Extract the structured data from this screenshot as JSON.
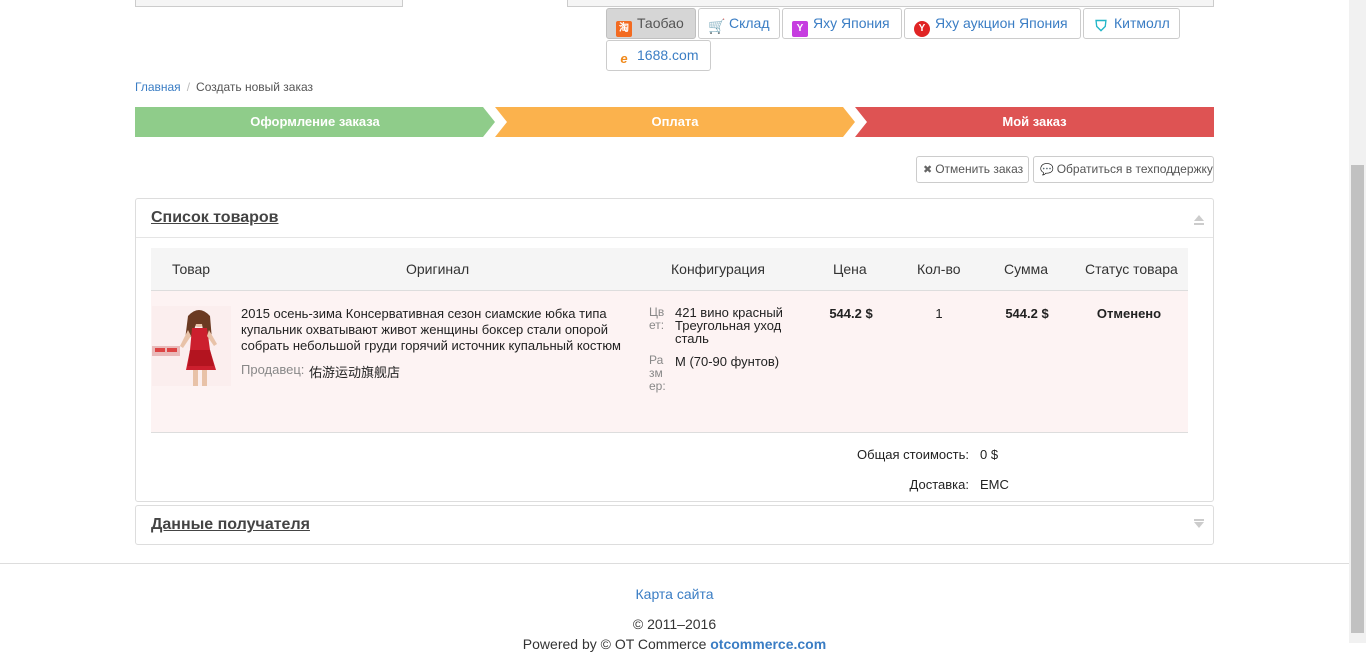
{
  "sources": {
    "tabs": [
      {
        "label": "Таобао",
        "icon": "taobao-icon",
        "active": true
      },
      {
        "label": "Склад",
        "icon": "warehouse-cart-icon"
      },
      {
        "label": "Яху Япония",
        "icon": "yahoo-icon"
      },
      {
        "label": "Яху аукцион Япония",
        "icon": "yahoo-auction-icon"
      },
      {
        "label": "Китмолл",
        "icon": "kitmall-icon"
      },
      {
        "label": "1688.com",
        "icon": "1688-icon"
      }
    ]
  },
  "breadcrumb": {
    "home": "Главная",
    "separator": "/",
    "current": "Создать новый заказ"
  },
  "steps": {
    "step1": "Оформление заказа",
    "step2": "Оплата",
    "step3": "Мой заказ",
    "colors": {
      "step1": "#8fcc8a",
      "step2": "#fbb24d",
      "step3": "#de5353"
    }
  },
  "actions": {
    "cancel": "Отменить заказ",
    "support": "Обратиться в техподдержку"
  },
  "products_panel": {
    "title": "Список товаров",
    "columns": {
      "product": "Товар",
      "original": "Оригинал",
      "config": "Конфигурация",
      "price": "Цена",
      "qty": "Кол-во",
      "sum": "Сумма",
      "status": "Статус товара"
    },
    "rows": [
      {
        "title": "2015 осень-зима Консервативная сезон сиамские юбка типа купальник охватывают живот женщины боксер стали опорой собрать небольшой груди горячий источник купальный костюм",
        "seller_label": "Продавец:",
        "seller": "佑游运动旗舰店",
        "color_label": "Цвет:",
        "color_value": "421 вино красный Треугольная уход сталь",
        "size_label": "Размер:",
        "size_value": "M (70-90 фунтов)",
        "price": "544.2 $",
        "qty": "1",
        "sum": "544.2 $",
        "status": "Отменено"
      }
    ],
    "totals": {
      "total_label": "Общая стоимость:",
      "total_value": "0 $",
      "delivery_label": "Доставка:",
      "delivery_value": "EMC"
    }
  },
  "recipient_panel": {
    "title": "Данные получателя"
  },
  "footer": {
    "sitemap": "Карта сайта",
    "copyright": "© 2011–2016",
    "powered_prefix": "Powered by © OT Commerce",
    "powered_brand": "otcommerce.com"
  }
}
